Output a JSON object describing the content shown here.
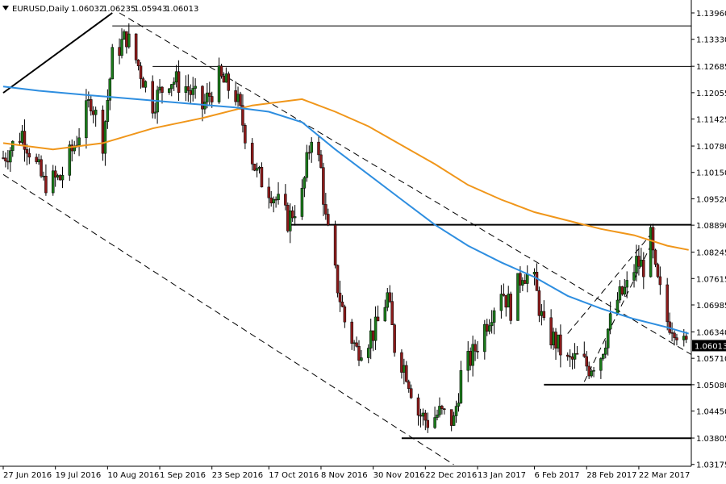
{
  "header": {
    "icon": "dropdown-triangle-icon",
    "symbol": "EURUSD,Daily",
    "open": "1.06032",
    "high": "1.06235",
    "low": "1.05943",
    "close": "1.06013"
  },
  "chart_data": {
    "type": "candlestick",
    "price_axis": {
      "min": 1.0317,
      "max": 1.1396,
      "ticks": [
        "1.13960",
        "1.13330",
        "1.12685",
        "1.12055",
        "1.11425",
        "1.10780",
        "1.10150",
        "1.09520",
        "1.08890",
        "1.08245",
        "1.07615",
        "1.06985",
        "1.06340",
        "1.05710",
        "1.05080",
        "1.04450",
        "1.03805",
        "1.03175"
      ]
    },
    "time_axis": {
      "start": "27 Jun 2016",
      "end": "31 Mar 2017",
      "ticks": [
        {
          "label": "27 Jun 2016",
          "date": "2016-06-27"
        },
        {
          "label": "19 Jul 2016",
          "date": "2016-07-19"
        },
        {
          "label": "10 Aug 2016",
          "date": "2016-08-10"
        },
        {
          "label": "1 Sep 2016",
          "date": "2016-09-01"
        },
        {
          "label": "23 Sep 2016",
          "date": "2016-09-23"
        },
        {
          "label": "17 Oct 2016",
          "date": "2016-10-17"
        },
        {
          "label": "8 Nov 2016",
          "date": "2016-11-08"
        },
        {
          "label": "30 Nov 2016",
          "date": "2016-11-30"
        },
        {
          "label": "22 Dec 2016",
          "date": "2016-12-22"
        },
        {
          "label": "13 Jan 2017",
          "date": "2017-01-13"
        },
        {
          "label": "6 Feb 2017",
          "date": "2017-02-06"
        },
        {
          "label": "28 Feb 2017",
          "date": "2017-02-28"
        },
        {
          "label": "22 Mar 2017",
          "date": "2017-03-22"
        }
      ]
    },
    "current_price": "1.06013",
    "colors": {
      "bull": "#1a7a1a",
      "bear": "#8b1a1a",
      "ma_fast": "#2e8ee0",
      "ma_slow": "#f0961a",
      "line": "#000000",
      "price_tag": "#000000"
    },
    "price_path": [
      [
        "2016-06-27",
        1.105
      ],
      [
        "2016-07-05",
        1.111
      ],
      [
        "2016-07-14",
        1.099
      ],
      [
        "2016-07-21",
        1.1
      ],
      [
        "2016-07-27",
        1.108
      ],
      [
        "2016-08-03",
        1.119
      ],
      [
        "2016-08-08",
        1.109
      ],
      [
        "2016-08-12",
        1.129
      ],
      [
        "2016-08-18",
        1.134
      ],
      [
        "2016-08-23",
        1.127
      ],
      [
        "2016-08-29",
        1.118
      ],
      [
        "2016-09-05",
        1.124
      ],
      [
        "2016-09-12",
        1.122
      ],
      [
        "2016-09-19",
        1.117
      ],
      [
        "2016-09-26",
        1.124
      ],
      [
        "2016-10-03",
        1.12
      ],
      [
        "2016-10-07",
        1.111
      ],
      [
        "2016-10-12",
        1.101
      ],
      [
        "2016-10-18",
        1.097
      ],
      [
        "2016-10-25",
        1.09
      ],
      [
        "2016-10-31",
        1.096
      ],
      [
        "2016-11-04",
        1.111
      ],
      [
        "2016-11-08",
        1.102
      ],
      [
        "2016-11-10",
        1.09
      ],
      [
        "2016-11-14",
        1.077
      ],
      [
        "2016-11-18",
        1.066
      ],
      [
        "2016-11-23",
        1.059
      ],
      [
        "2016-11-28",
        1.062
      ],
      [
        "2016-12-01",
        1.064
      ],
      [
        "2016-12-06",
        1.072
      ],
      [
        "2016-12-09",
        1.06
      ],
      [
        "2016-12-14",
        1.054
      ],
      [
        "2016-12-19",
        1.044
      ],
      [
        "2016-12-23",
        1.042
      ],
      [
        "2016-12-28",
        1.044
      ],
      [
        "2017-01-03",
        1.042
      ],
      [
        "2017-01-06",
        1.053
      ],
      [
        "2017-01-11",
        1.058
      ],
      [
        "2017-01-17",
        1.066
      ],
      [
        "2017-01-23",
        1.074
      ],
      [
        "2017-01-27",
        1.069
      ],
      [
        "2017-02-01",
        1.078
      ],
      [
        "2017-02-06",
        1.075
      ],
      [
        "2017-02-10",
        1.064
      ],
      [
        "2017-02-15",
        1.061
      ],
      [
        "2017-02-20",
        1.056
      ],
      [
        "2017-02-24",
        1.057
      ],
      [
        "2017-03-01",
        1.055
      ],
      [
        "2017-03-06",
        1.058
      ],
      [
        "2017-03-09",
        1.064
      ],
      [
        "2017-03-13",
        1.071
      ],
      [
        "2017-03-17",
        1.074
      ],
      [
        "2017-03-21",
        1.08
      ],
      [
        "2017-03-24",
        1.079
      ],
      [
        "2017-03-27",
        1.0855
      ],
      [
        "2017-03-29",
        1.077
      ],
      [
        "2017-04-03",
        1.066
      ],
      [
        "2017-04-06",
        1.065
      ],
      [
        "2017-04-10",
        1.06
      ],
      [
        "2017-04-12",
        1.0601
      ]
    ],
    "ma_fast": [
      [
        "2016-06-27",
        1.122
      ],
      [
        "2016-07-12",
        1.121
      ],
      [
        "2016-08-01",
        1.12
      ],
      [
        "2016-08-22",
        1.119
      ],
      [
        "2016-09-12",
        1.118
      ],
      [
        "2016-10-03",
        1.117
      ],
      [
        "2016-10-17",
        1.116
      ],
      [
        "2016-10-31",
        1.1135
      ],
      [
        "2016-11-14",
        1.107
      ],
      [
        "2016-11-28",
        1.101
      ],
      [
        "2016-12-12",
        1.095
      ],
      [
        "2016-12-26",
        1.089
      ],
      [
        "2017-01-09",
        1.084
      ],
      [
        "2017-01-23",
        1.08
      ],
      [
        "2017-02-06",
        1.0765
      ],
      [
        "2017-02-20",
        1.072
      ],
      [
        "2017-03-06",
        1.069
      ],
      [
        "2017-03-20",
        1.0665
      ],
      [
        "2017-04-03",
        1.0645
      ],
      [
        "2017-04-12",
        1.063
      ]
    ],
    "ma_slow": [
      [
        "2016-06-27",
        1.1085
      ],
      [
        "2016-07-18",
        1.107
      ],
      [
        "2016-08-08",
        1.1085
      ],
      [
        "2016-08-29",
        1.112
      ],
      [
        "2016-09-19",
        1.1145
      ],
      [
        "2016-10-10",
        1.1175
      ],
      [
        "2016-10-31",
        1.119
      ],
      [
        "2016-11-14",
        1.116
      ],
      [
        "2016-11-28",
        1.1125
      ],
      [
        "2016-12-12",
        1.108
      ],
      [
        "2016-12-26",
        1.1035
      ],
      [
        "2017-01-09",
        1.0985
      ],
      [
        "2017-01-23",
        1.095
      ],
      [
        "2017-02-06",
        1.092
      ],
      [
        "2017-02-20",
        1.09
      ],
      [
        "2017-03-06",
        1.088
      ],
      [
        "2017-03-20",
        1.0865
      ],
      [
        "2017-04-03",
        1.084
      ],
      [
        "2017-04-12",
        1.083
      ]
    ],
    "horizontal_levels": [
      {
        "price": 1.1365,
        "from": "2016-08-12",
        "to": "2017-04-24",
        "style": "thin"
      },
      {
        "price": 1.1268,
        "from": "2016-08-29",
        "to": "2017-04-24",
        "style": "thin"
      },
      {
        "price": 1.089,
        "from": "2016-10-26",
        "to": "2017-04-24",
        "style": "thick"
      },
      {
        "price": 1.0508,
        "from": "2017-02-10",
        "to": "2017-04-24",
        "style": "thick"
      },
      {
        "price": 1.038,
        "from": "2016-12-12",
        "to": "2017-04-24",
        "style": "thick"
      }
    ],
    "trend_lines": [
      {
        "from": [
          "2016-06-27",
          1.1205
        ],
        "to": [
          "2016-08-12",
          1.1396
        ],
        "style": "solid-thick"
      },
      {
        "from": [
          "2016-08-15",
          1.1396
        ],
        "to": [
          "2017-04-24",
          1.058
        ],
        "style": "dashed"
      },
      {
        "from": [
          "2016-06-27",
          1.101
        ],
        "to": [
          "2017-01-03",
          1.0317
        ],
        "style": "dashed"
      },
      {
        "from": [
          "2017-02-27",
          1.0515
        ],
        "to": [
          "2017-03-27",
          1.084
        ],
        "style": "dashed"
      },
      {
        "from": [
          "2017-02-20",
          1.063
        ],
        "to": [
          "2017-03-29",
          1.088
        ],
        "style": "dashed"
      }
    ]
  }
}
